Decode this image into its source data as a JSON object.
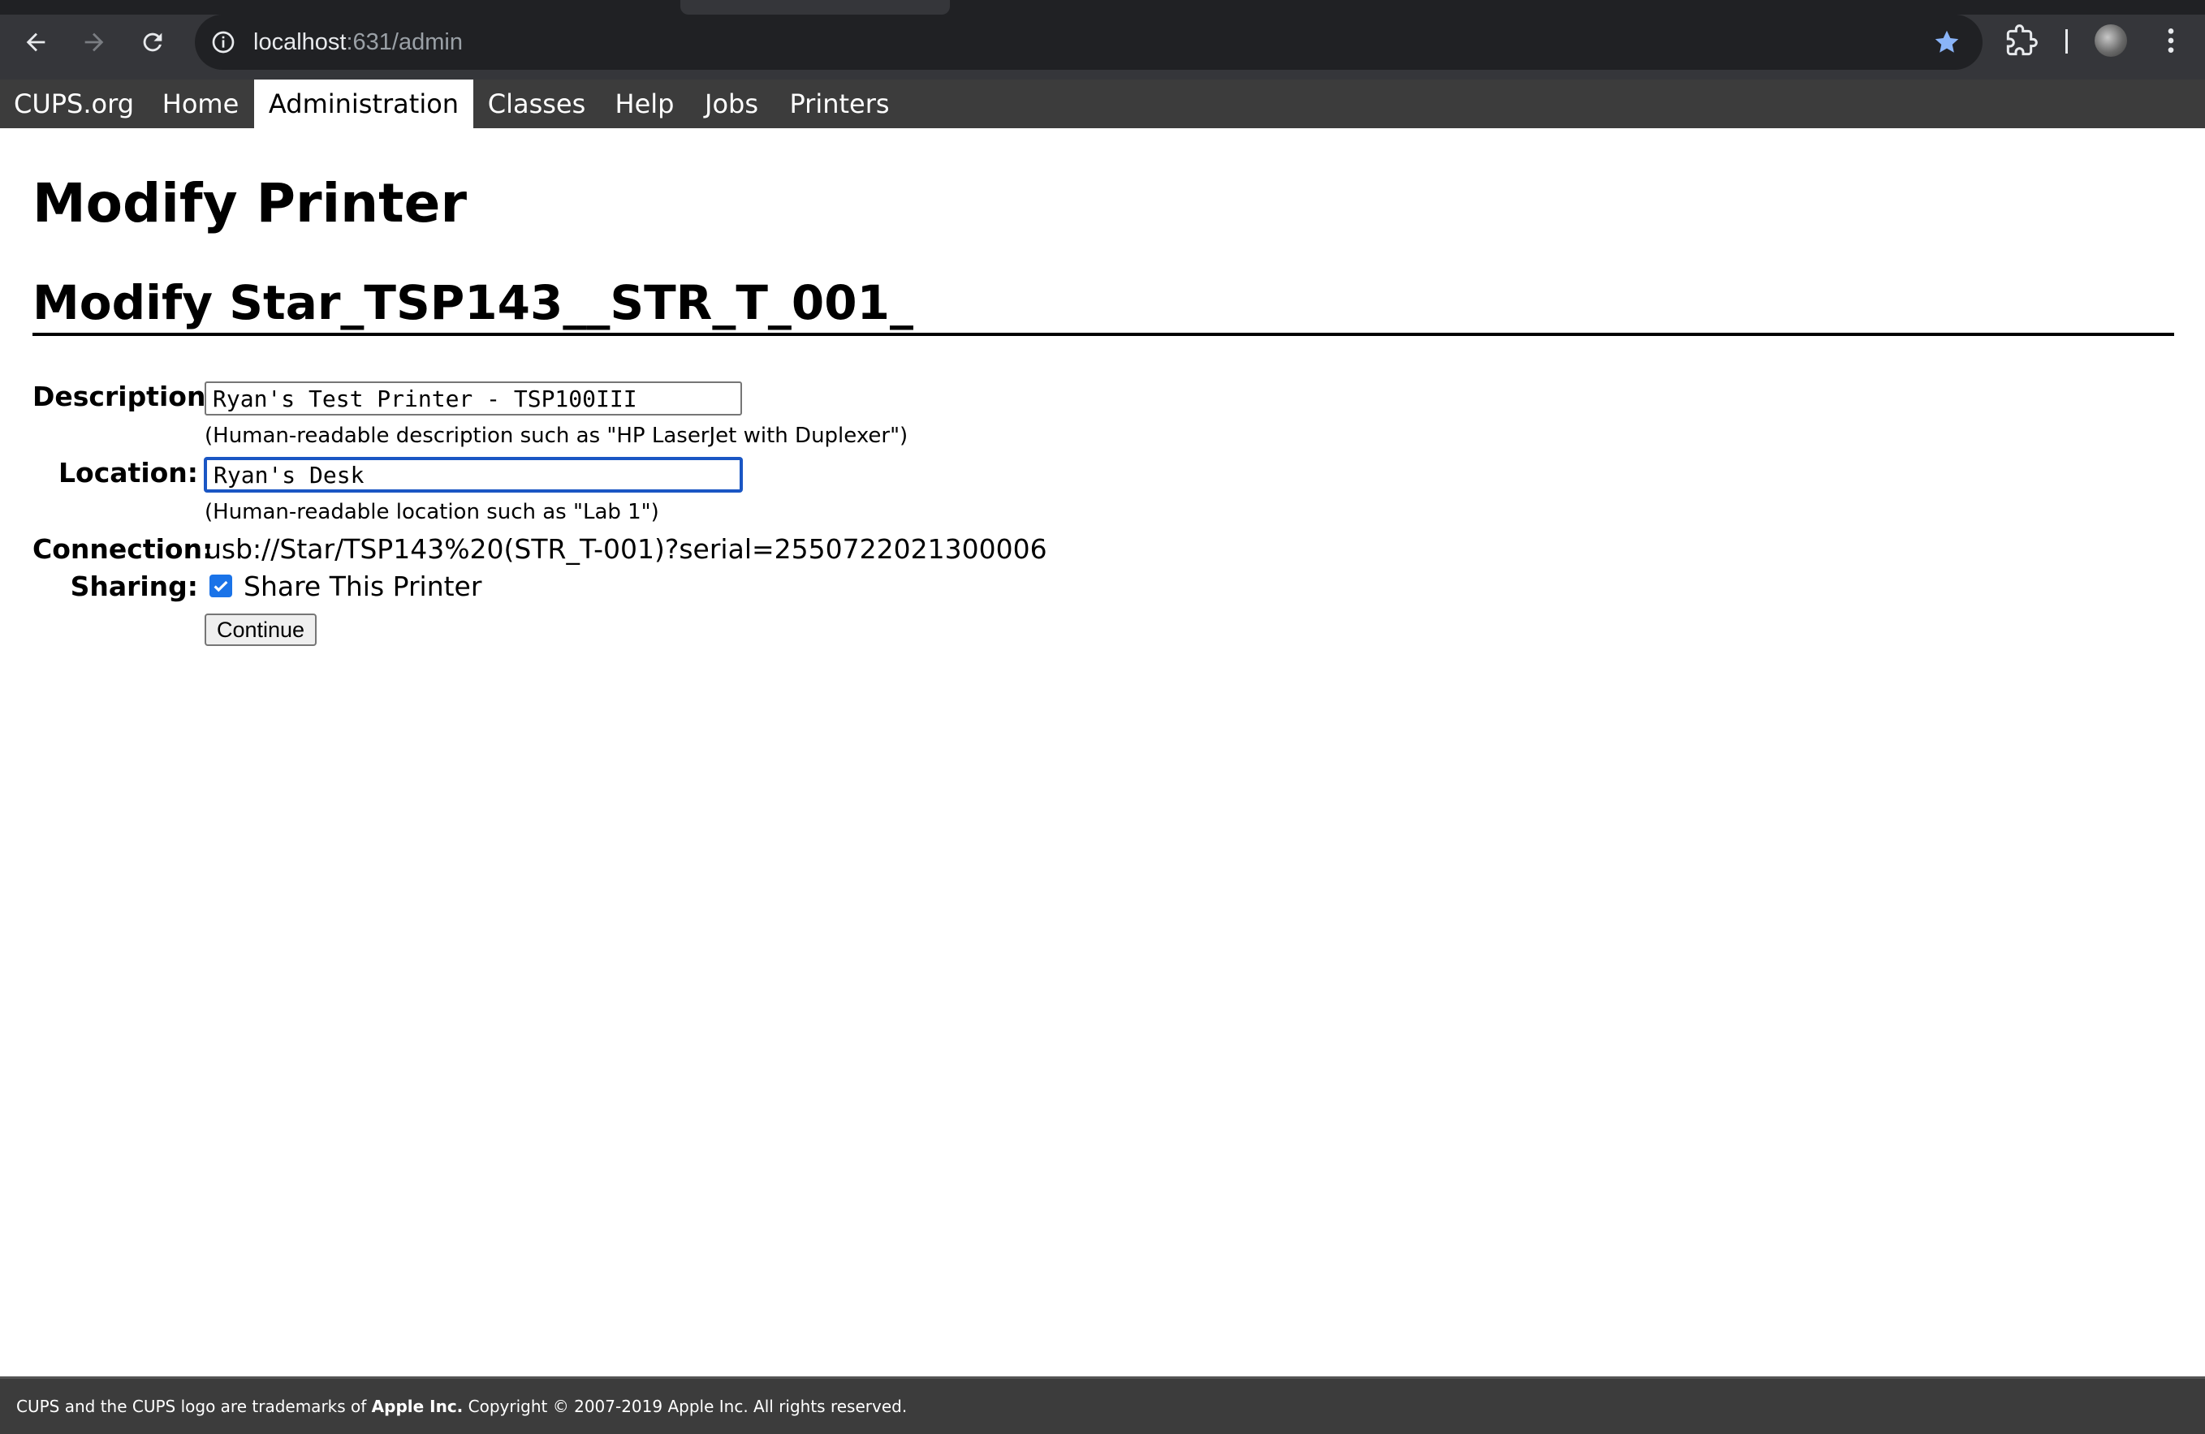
{
  "browser": {
    "url_host": "localhost",
    "url_path": ":631/admin"
  },
  "nav": {
    "items": [
      {
        "label": "CUPS.org",
        "active": false
      },
      {
        "label": "Home",
        "active": false
      },
      {
        "label": "Administration",
        "active": true
      },
      {
        "label": "Classes",
        "active": false
      },
      {
        "label": "Help",
        "active": false
      },
      {
        "label": "Jobs",
        "active": false
      },
      {
        "label": "Printers",
        "active": false
      }
    ]
  },
  "page": {
    "title": "Modify Printer",
    "section_title": "Modify Star_TSP143__STR_T_001_"
  },
  "form": {
    "description_label": "Description:",
    "description_value": "Ryan's Test Printer - TSP100III",
    "description_hint": "(Human-readable description such as \"HP LaserJet with Duplexer\")",
    "location_label": "Location:",
    "location_value": "Ryan's Desk",
    "location_hint": "(Human-readable location such as \"Lab 1\")",
    "connection_label": "Connection:",
    "connection_value": "usb://Star/TSP143%20(STR_T-001)?serial=2550722021300006",
    "sharing_label": "Sharing:",
    "sharing_checked": true,
    "sharing_option": "Share This Printer",
    "continue_label": "Continue"
  },
  "footer": {
    "text_prefix": "CUPS and the CUPS logo are trademarks of ",
    "text_company": "Apple Inc.",
    "text_suffix": " Copyright © 2007-2019 Apple Inc. All rights reserved."
  }
}
